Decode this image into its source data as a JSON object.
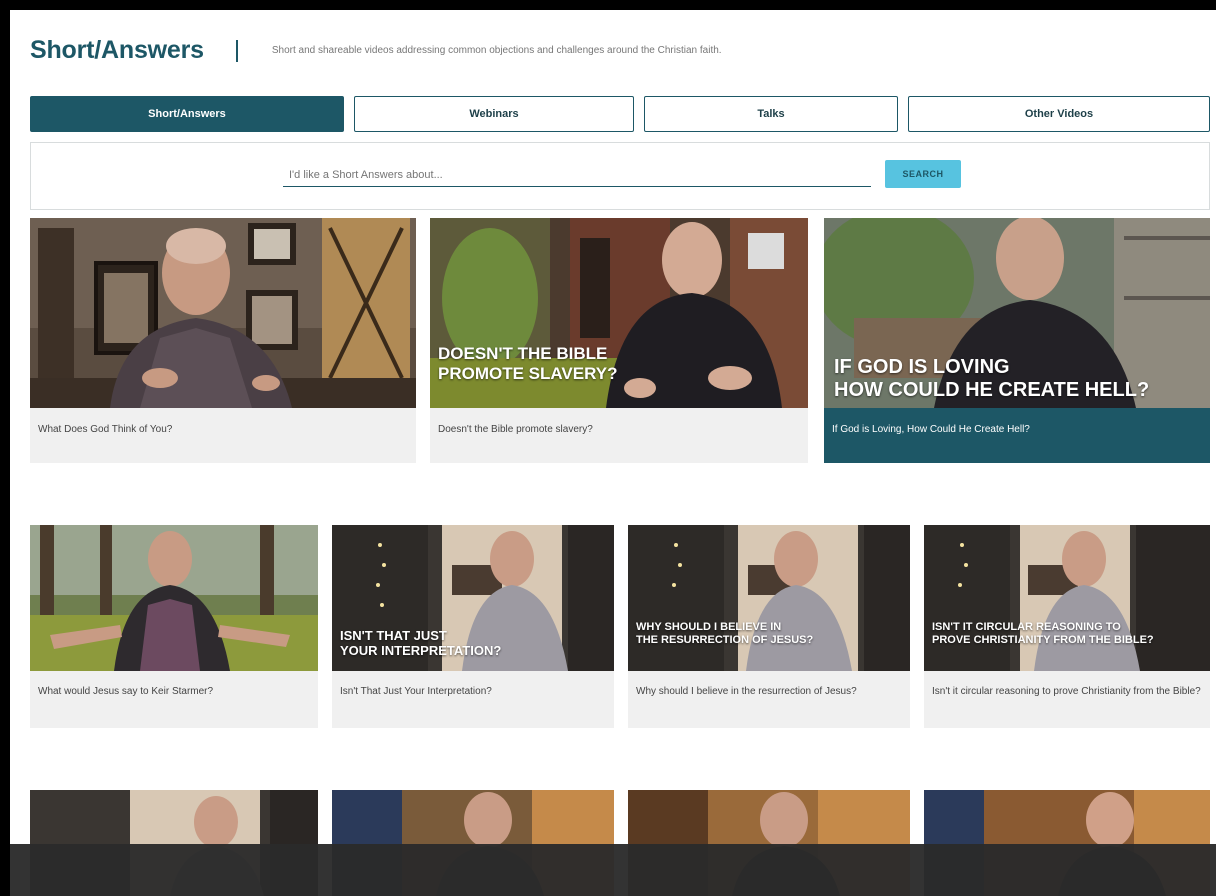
{
  "header": {
    "brand": "Short/Answers",
    "tagline": "Short and shareable videos addressing common objections and challenges around the Christian faith."
  },
  "tabs": [
    {
      "label": "Short/Answers"
    },
    {
      "label": "Webinars"
    },
    {
      "label": "Talks"
    },
    {
      "label": "Other Videos"
    }
  ],
  "search": {
    "placeholder": "I'd like a Short Answers about...",
    "button_label": "SEARCH"
  },
  "row1": [
    {
      "caption": "What Does God Think of You?",
      "overlay": ""
    },
    {
      "caption": "Doesn't the Bible promote slavery?",
      "overlay": "DOESN'T THE BIBLE\nPROMOTE SLAVERY?"
    },
    {
      "caption": "If God is Loving, How Could He Create Hell?",
      "overlay": "IF GOD IS LOVING\nHOW COULD HE CREATE HELL?"
    }
  ],
  "row2": [
    {
      "caption": "What would Jesus say to Keir Starmer?",
      "overlay": ""
    },
    {
      "caption": "Isn't That Just Your Interpretation?",
      "overlay": "ISN'T THAT JUST\nYOUR INTERPRETATION?"
    },
    {
      "caption": "Why should I believe in the resurrection of Jesus?",
      "overlay": "WHY SHOULD I BELIEVE IN\nTHE RESURRECTION OF JESUS?"
    },
    {
      "caption": "Isn't it circular reasoning to prove Christianity from the Bible?",
      "overlay": "ISN'T IT CIRCULAR REASONING TO\nPROVE CHRISTIANITY FROM THE BIBLE?"
    }
  ],
  "colors": {
    "brand": "#1d5766",
    "accent": "#57c3e0"
  }
}
